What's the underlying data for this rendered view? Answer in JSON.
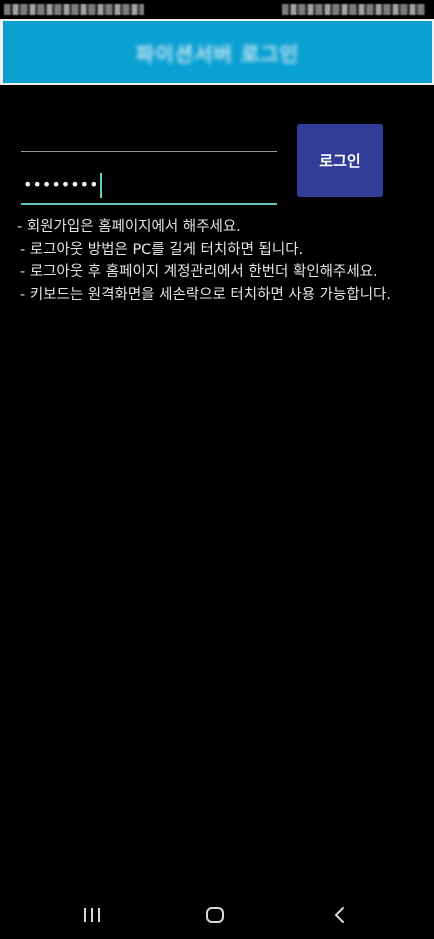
{
  "status_bar": {
    "left_text": "",
    "right_text": ""
  },
  "app_bar": {
    "title": "파이션서버 로그인"
  },
  "login_form": {
    "id_value": "",
    "password_value": "••••••••",
    "login_button_label": "로그인"
  },
  "notes": [
    "- 회원가입은 홈페이지에서 해주세요.",
    "- 로그아웃 방법은 PC를 길게 터치하면 됩니다.",
    "- 로그아웃 후 홈페이지 계정관리에서 한번더 확인해주세요.",
    "- 키보드는 원격화면을 세손락으로 터치하면 사용 가능합니다."
  ],
  "nav_bar": {
    "icons": [
      "recent-apps-icon",
      "home-icon",
      "back-icon"
    ]
  },
  "colors": {
    "app_bar": "#0aa0d2",
    "login_button": "#2f3d98",
    "focused_underline": "#63c7c0",
    "background": "#000000"
  }
}
